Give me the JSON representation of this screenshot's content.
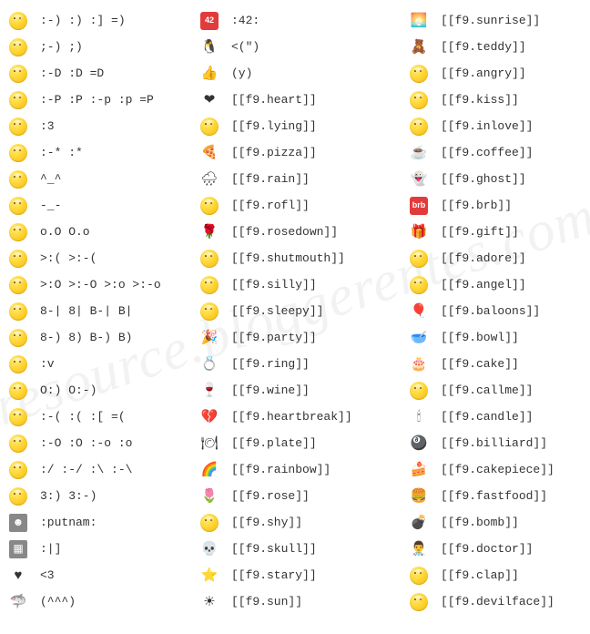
{
  "watermark": "resource.bloggerentes.com",
  "columns": [
    [
      {
        "glyph": "",
        "cls": "yel face",
        "code": ":-) :) :] =)"
      },
      {
        "glyph": "",
        "cls": "yel face",
        "code": ";-) ;)"
      },
      {
        "glyph": "",
        "cls": "yel face",
        "code": ":-D :D =D"
      },
      {
        "glyph": "",
        "cls": "yel face",
        "code": ":-P :P :-p :p =P"
      },
      {
        "glyph": "",
        "cls": "yel face",
        "code": ":3"
      },
      {
        "glyph": "",
        "cls": "yel face",
        "code": ":-* :*"
      },
      {
        "glyph": "",
        "cls": "yel face",
        "code": "^_^"
      },
      {
        "glyph": "",
        "cls": "yel face",
        "code": "-_-"
      },
      {
        "glyph": "",
        "cls": "yel face",
        "code": "o.O O.o"
      },
      {
        "glyph": "",
        "cls": "yel face",
        "code": ">:( >:-("
      },
      {
        "glyph": "",
        "cls": "yel face",
        "code": ">:O >:-O >:o >:-o"
      },
      {
        "glyph": "",
        "cls": "yel face",
        "code": "8-| 8| B-| B|"
      },
      {
        "glyph": "",
        "cls": "yel face",
        "code": "8-) 8) B-) B)"
      },
      {
        "glyph": "",
        "cls": "yel face",
        "code": ":v"
      },
      {
        "glyph": "",
        "cls": "yel face",
        "code": "O:) O:-)"
      },
      {
        "glyph": "",
        "cls": "yel face",
        "code": ":-( :( :[ =("
      },
      {
        "glyph": "",
        "cls": "yel face",
        "code": ":-O :O :-o :o"
      },
      {
        "glyph": "",
        "cls": "yel face",
        "code": ":/ :-/ :\\ :-\\"
      },
      {
        "glyph": "",
        "cls": "yel face",
        "code": "3:) 3:-)"
      },
      {
        "glyph": "☻",
        "cls": "pix",
        "code": ":putnam:"
      },
      {
        "glyph": "▦",
        "cls": "pix",
        "code": ":|]"
      },
      {
        "glyph": "♥",
        "cls": "emoji",
        "code": "<3"
      },
      {
        "glyph": "🦈",
        "cls": "emoji",
        "code": "(^^^)"
      }
    ],
    [
      {
        "glyph": "42",
        "cls": "sq red",
        "code": ":42:"
      },
      {
        "glyph": "🐧",
        "cls": "emoji",
        "code": "<(\")"
      },
      {
        "glyph": "👍",
        "cls": "emoji",
        "code": "(y)"
      },
      {
        "glyph": "❤",
        "cls": "emoji",
        "code": "[[f9.heart]]"
      },
      {
        "glyph": "",
        "cls": "yel face",
        "code": "[[f9.lying]]"
      },
      {
        "glyph": "🍕",
        "cls": "emoji",
        "code": "[[f9.pizza]]"
      },
      {
        "glyph": "🌧",
        "cls": "emoji",
        "code": "[[f9.rain]]"
      },
      {
        "glyph": "",
        "cls": "yel face",
        "code": "[[f9.rofl]]"
      },
      {
        "glyph": "🌹",
        "cls": "emoji",
        "code": "[[f9.rosedown]]"
      },
      {
        "glyph": "",
        "cls": "yel face",
        "code": "[[f9.shutmouth]]"
      },
      {
        "glyph": "",
        "cls": "yel face",
        "code": "[[f9.silly]]"
      },
      {
        "glyph": "",
        "cls": "yel face",
        "code": "[[f9.sleepy]]"
      },
      {
        "glyph": "🎉",
        "cls": "emoji",
        "code": "[[f9.party]]"
      },
      {
        "glyph": "💍",
        "cls": "emoji",
        "code": "[[f9.ring]]"
      },
      {
        "glyph": "🍷",
        "cls": "emoji",
        "code": "[[f9.wine]]"
      },
      {
        "glyph": "💔",
        "cls": "emoji",
        "code": "[[f9.heartbreak]]"
      },
      {
        "glyph": "🍽",
        "cls": "emoji",
        "code": "[[f9.plate]]"
      },
      {
        "glyph": "🌈",
        "cls": "emoji",
        "code": "[[f9.rainbow]]"
      },
      {
        "glyph": "🌷",
        "cls": "emoji",
        "code": "[[f9.rose]]"
      },
      {
        "glyph": "",
        "cls": "yel face",
        "code": "[[f9.shy]]"
      },
      {
        "glyph": "💀",
        "cls": "emoji",
        "code": "[[f9.skull]]"
      },
      {
        "glyph": "⭐",
        "cls": "emoji",
        "code": "[[f9.stary]]"
      },
      {
        "glyph": "☀",
        "cls": "emoji",
        "code": "[[f9.sun]]"
      }
    ],
    [
      {
        "glyph": "🌅",
        "cls": "emoji",
        "code": "[[f9.sunrise]]"
      },
      {
        "glyph": "🧸",
        "cls": "emoji",
        "code": "[[f9.teddy]]"
      },
      {
        "glyph": "",
        "cls": "yel face",
        "code": "[[f9.angry]]"
      },
      {
        "glyph": "",
        "cls": "yel face",
        "code": "[[f9.kiss]]"
      },
      {
        "glyph": "",
        "cls": "yel face",
        "code": "[[f9.inlove]]"
      },
      {
        "glyph": "☕",
        "cls": "emoji",
        "code": "[[f9.coffee]]"
      },
      {
        "glyph": "👻",
        "cls": "emoji",
        "code": "[[f9.ghost]]"
      },
      {
        "glyph": "brb",
        "cls": "sq red",
        "code": "[[f9.brb]]"
      },
      {
        "glyph": "🎁",
        "cls": "emoji",
        "code": "[[f9.gift]]"
      },
      {
        "glyph": "",
        "cls": "yel face",
        "code": "[[f9.adore]]"
      },
      {
        "glyph": "",
        "cls": "yel face",
        "code": "[[f9.angel]]"
      },
      {
        "glyph": "🎈",
        "cls": "emoji",
        "code": "[[f9.baloons]]"
      },
      {
        "glyph": "🥣",
        "cls": "emoji",
        "code": "[[f9.bowl]]"
      },
      {
        "glyph": "🎂",
        "cls": "emoji",
        "code": "[[f9.cake]]"
      },
      {
        "glyph": "",
        "cls": "yel face",
        "code": "[[f9.callme]]"
      },
      {
        "glyph": "🕯",
        "cls": "emoji",
        "code": "[[f9.candle]]"
      },
      {
        "glyph": "🎱",
        "cls": "emoji",
        "code": "[[f9.billiard]]"
      },
      {
        "glyph": "🍰",
        "cls": "emoji",
        "code": "[[f9.cakepiece]]"
      },
      {
        "glyph": "🍔",
        "cls": "emoji",
        "code": "[[f9.fastfood]]"
      },
      {
        "glyph": "💣",
        "cls": "emoji",
        "code": "[[f9.bomb]]"
      },
      {
        "glyph": "👨‍⚕️",
        "cls": "emoji",
        "code": "[[f9.doctor]]"
      },
      {
        "glyph": "",
        "cls": "yel face",
        "code": "[[f9.clap]]"
      },
      {
        "glyph": "",
        "cls": "yel face",
        "code": "[[f9.devilface]]"
      }
    ]
  ]
}
